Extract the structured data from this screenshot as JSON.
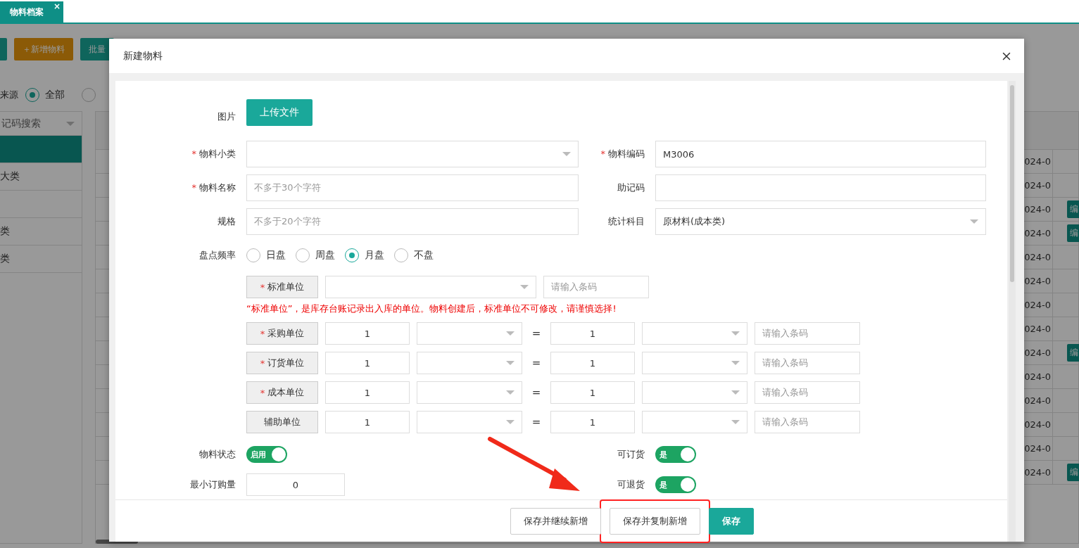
{
  "tab_bar": {
    "tabs": [
      {
        "label": "物料档案",
        "selected": true,
        "close": "×"
      }
    ]
  },
  "toolbar": {
    "buttons": [
      {
        "kind": "primary"
      },
      {
        "label": "＋新增物料",
        "kind": "warning"
      },
      {
        "label": "批量",
        "kind": "primary"
      }
    ]
  },
  "filter": {
    "label": "来源",
    "options": [
      {
        "label": "全部",
        "selected": true
      },
      {
        "selected": false
      }
    ]
  },
  "sidebar": {
    "search": "记码搜索",
    "items": [
      {
        "selected": true
      },
      {
        "label": "大类",
        "selected": false
      },
      {
        "selected": false
      },
      {
        "label": "类",
        "selected": false
      },
      {
        "label": "类",
        "selected": false
      }
    ]
  },
  "table": {
    "rows": [
      {
        "date": "024-0"
      },
      {
        "date": "024-0"
      },
      {
        "date": "024-0",
        "action": "编"
      },
      {
        "date": "024-0",
        "action": "编"
      },
      {
        "date": "024-0"
      },
      {
        "date": "024-0"
      },
      {
        "date": "024-0"
      },
      {
        "date": "024-0"
      },
      {
        "date": "024-0",
        "action": "编"
      },
      {
        "date": "024-0"
      },
      {
        "date": "024-0"
      },
      {
        "date": "024-0"
      },
      {
        "date": "024-0"
      },
      {
        "date": "024-0",
        "action": "编"
      }
    ]
  },
  "modal": {
    "title": "新建物料",
    "required_mark": "*",
    "picture": {
      "label": "图片",
      "button": "上传文件"
    },
    "fields": [
      {
        "label": "物料小类",
        "required": true,
        "kind": "select"
      },
      {
        "label": "物料编码",
        "required": true,
        "kind": "input",
        "value": "M3006"
      },
      {
        "label": "物料名称",
        "required": true,
        "kind": "input",
        "placeholder": "不多于30个字符"
      },
      {
        "label": "助记码",
        "required": false,
        "kind": "input"
      },
      {
        "label": "规格",
        "required": false,
        "kind": "input",
        "placeholder": "不多于20个字符"
      },
      {
        "label": "统计科目",
        "required": false,
        "kind": "select",
        "value": "原材料(成本类)"
      }
    ],
    "frequency": {
      "label": "盘点频率",
      "options": [
        {
          "label": "日盘",
          "selected": false
        },
        {
          "label": "周盘",
          "selected": false
        },
        {
          "label": "月盘",
          "selected": true
        },
        {
          "label": "不盘",
          "selected": false
        }
      ]
    },
    "base_unit": {
      "label": "标准单位",
      "required": true,
      "barcode_placeholder": "请输入条码",
      "warning": "“标准单位”，是库存台账记录出入库的单位。物料创建后，标准单位不可修改，请谨慎选择!"
    },
    "unit_rows": [
      {
        "label": "采购单位",
        "required": true,
        "qty": "1",
        "equals": "=",
        "base_qty": "1",
        "barcode_placeholder": "请输入条码"
      },
      {
        "label": "订货单位",
        "required": true,
        "qty": "1",
        "equals": "=",
        "base_qty": "1",
        "barcode_placeholder": "请输入条码"
      },
      {
        "label": "成本单位",
        "required": true,
        "qty": "1",
        "equals": "=",
        "base_qty": "1",
        "barcode_placeholder": "请输入条码"
      },
      {
        "label": "辅助单位",
        "required": false,
        "qty": "1",
        "equals": "=",
        "base_qty": "1",
        "barcode_placeholder": "请输入条码"
      }
    ],
    "status": {
      "label": "物料状态",
      "on": true,
      "text": "启用"
    },
    "min_order": {
      "label": "最小订购量",
      "value": "0"
    },
    "orderable": {
      "label": "可订货",
      "on": true,
      "text": "是"
    },
    "returnable": {
      "label": "可退货",
      "on": true,
      "text": "是"
    },
    "footer_buttons": [
      {
        "label": "保存并继续新增",
        "kind": "default",
        "highlighted": false
      },
      {
        "label": "保存并复制新增",
        "kind": "default",
        "highlighted": true
      },
      {
        "label": "保存",
        "kind": "primary",
        "highlighted": false
      }
    ]
  }
}
